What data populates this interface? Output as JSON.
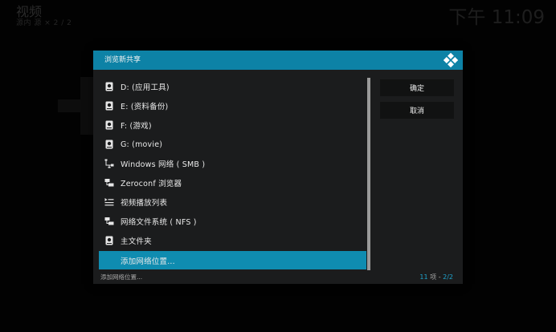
{
  "header": {
    "title": "视频",
    "subtitle": "源内 源 × 2 / 2",
    "clock": "下午 11:09"
  },
  "dialog": {
    "title": "浏览新共享",
    "items": [
      {
        "label": "D: (应用工具)",
        "icon": "harddisk-icon"
      },
      {
        "label": "E: (资料备份)",
        "icon": "harddisk-icon"
      },
      {
        "label": "F: (游戏)",
        "icon": "harddisk-icon"
      },
      {
        "label": "G: (movie)",
        "icon": "harddisk-icon"
      },
      {
        "label": "Windows 网络 ( SMB )",
        "icon": "network-icon"
      },
      {
        "label": "Zeroconf 浏览器",
        "icon": "network-share-icon"
      },
      {
        "label": "视频播放列表",
        "icon": "playlist-icon"
      },
      {
        "label": "网络文件系统 ( NFS )",
        "icon": "network-share-icon"
      },
      {
        "label": "主文件夹",
        "icon": "harddisk-icon"
      },
      {
        "label": "添加网络位置...",
        "icon": "",
        "selected": true
      }
    ],
    "buttons": {
      "ok": "确定",
      "cancel": "取消"
    },
    "footer": {
      "left": "添加网络位置...",
      "count": "11",
      "count_suffix": " 项 - ",
      "page": "2/2"
    }
  },
  "colors": {
    "accent": "#0d82a6",
    "selected": "#0f8cb0",
    "count_accent": "#1fa3cc"
  }
}
